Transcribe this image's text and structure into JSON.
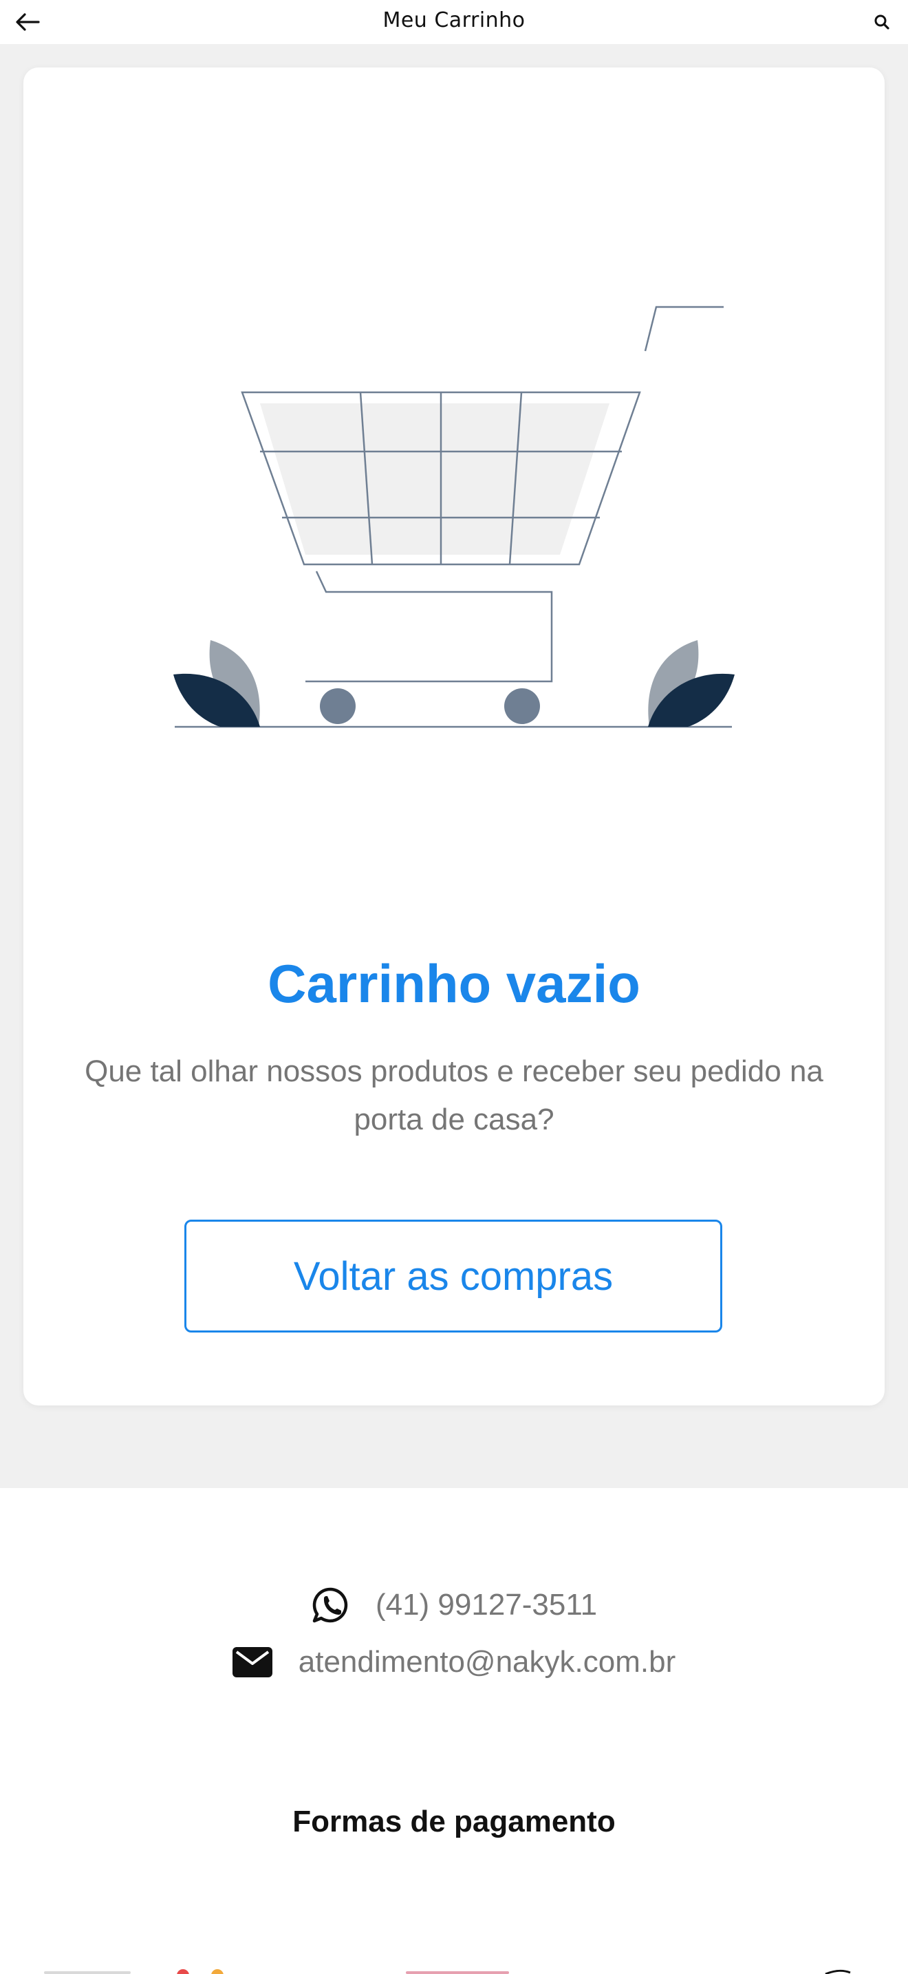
{
  "header": {
    "title": "Meu Carrinho",
    "back_icon": "arrow-left-icon",
    "search_icon": "search-icon"
  },
  "empty_cart": {
    "illustration": "empty-shopping-cart-illustration",
    "title": "Carrinho vazio",
    "subtitle": "Que tal olhar nossos produtos e receber seu pedido na porta de casa?",
    "button_label": "Voltar as compras"
  },
  "footer": {
    "whatsapp_icon": "whatsapp-icon",
    "phone": "(41) 99127-3511",
    "email_icon": "envelope-icon",
    "email": "atendimento@nakyk.com.br",
    "payments_title": "Formas de pagamento"
  },
  "colors": {
    "accent": "#1a86ea",
    "background_grey": "#f0f0f0",
    "text_grey": "#757575",
    "illustration_dark": "#142d47",
    "illustration_grey": "#9aa3ad",
    "illustration_line": "#6f7f93"
  }
}
